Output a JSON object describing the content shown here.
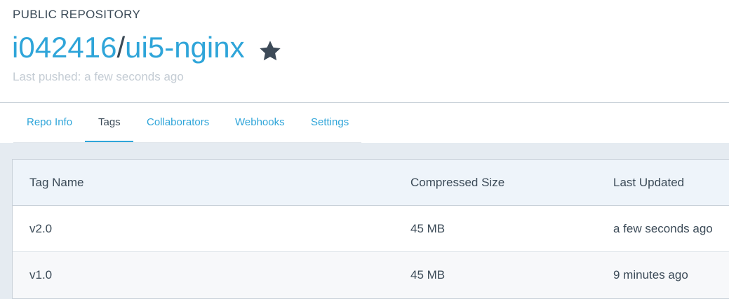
{
  "header": {
    "repo_type": "PUBLIC REPOSITORY",
    "namespace": "i042416",
    "separator": "/",
    "repo_name": "ui5-nginx",
    "star_icon": "star-icon",
    "last_pushed": "Last pushed: a few seconds ago"
  },
  "tabs": [
    {
      "label": "Repo Info",
      "active": false
    },
    {
      "label": "Tags",
      "active": true
    },
    {
      "label": "Collaborators",
      "active": false
    },
    {
      "label": "Webhooks",
      "active": false
    },
    {
      "label": "Settings",
      "active": false
    }
  ],
  "tags_table": {
    "columns": [
      "Tag Name",
      "Compressed Size",
      "Last Updated"
    ],
    "rows": [
      {
        "tag": "v2.0",
        "size": "45 MB",
        "updated": "a few seconds ago"
      },
      {
        "tag": "v1.0",
        "size": "45 MB",
        "updated": "9 minutes ago"
      }
    ]
  },
  "colors": {
    "accent": "#2fa5d9",
    "text": "#3b4a57",
    "muted": "#c4ccd4",
    "content_bg": "#e5ebf1",
    "table_header_bg": "#eef4fa"
  }
}
